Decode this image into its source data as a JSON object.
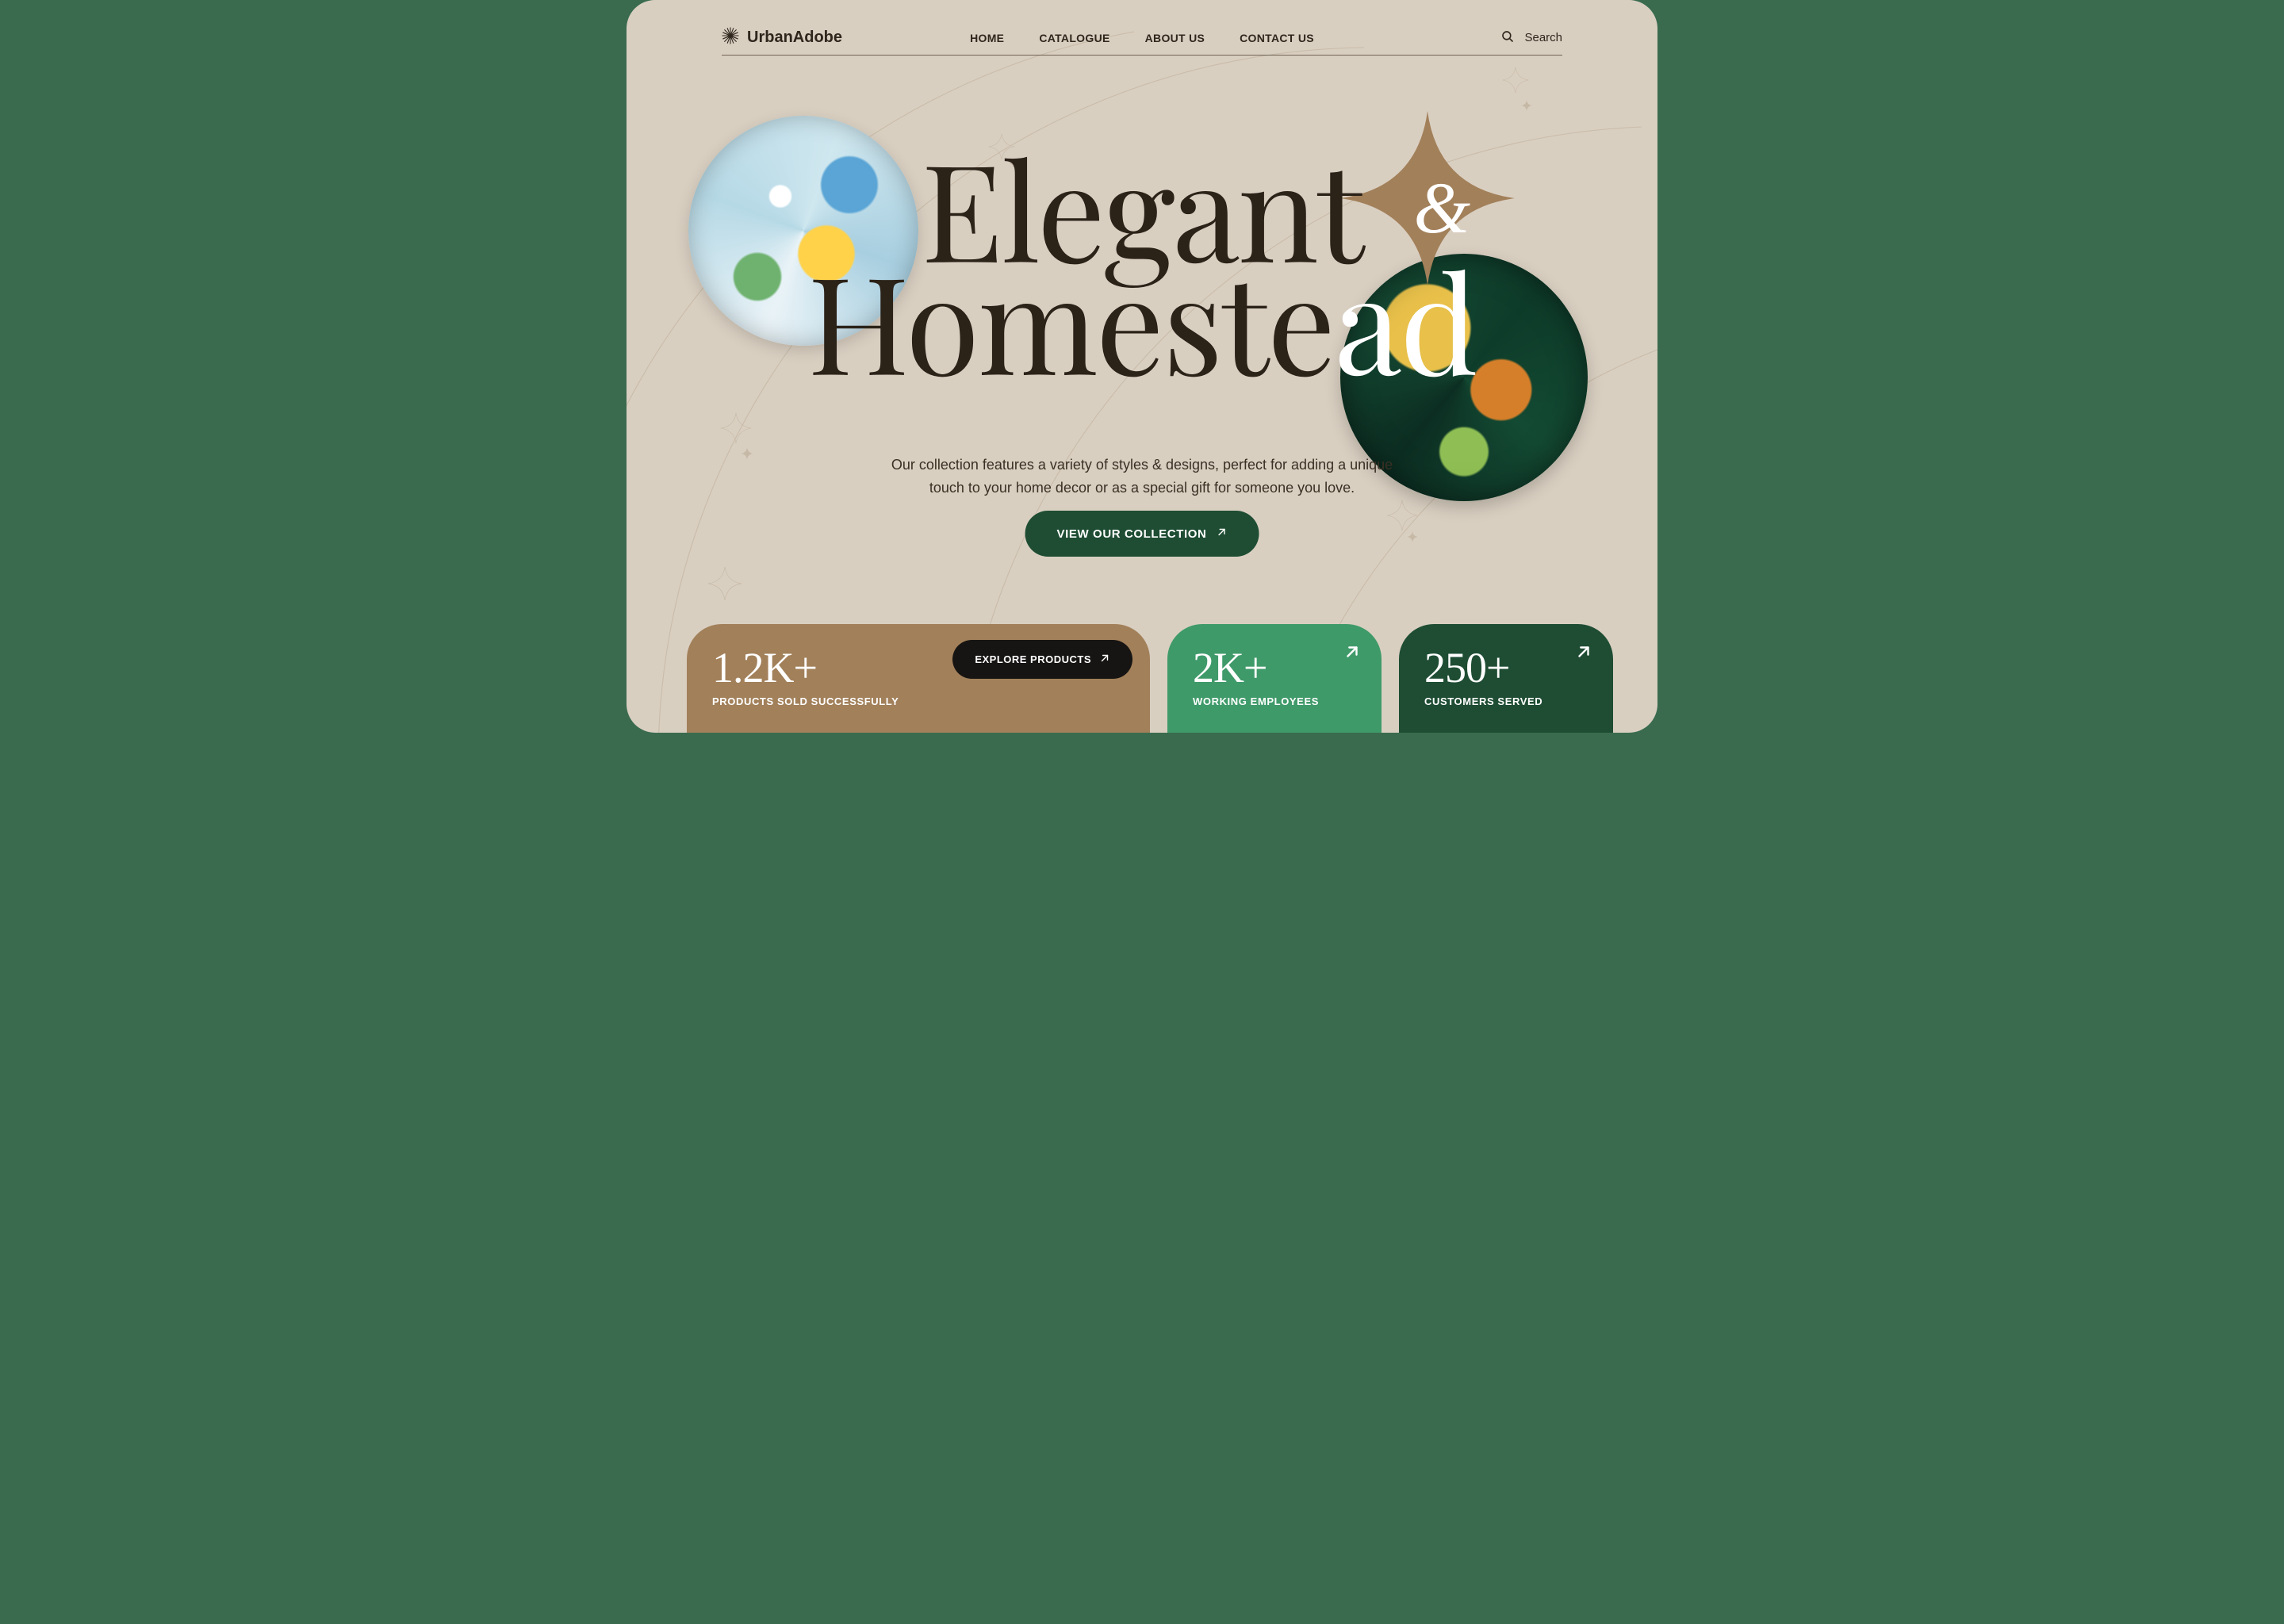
{
  "brand": {
    "name": "UrbanAdobe"
  },
  "nav": {
    "items": [
      {
        "label": "HOME"
      },
      {
        "label": "CATALOGUE"
      },
      {
        "label": "ABOUT US"
      },
      {
        "label": "CONTACT US"
      }
    ]
  },
  "search": {
    "label": "Search"
  },
  "hero": {
    "line1": "Elegant",
    "line2_prefix": "Homeste",
    "line2_suffix": "ad",
    "amp": "&",
    "sub_line1": "Our collection features a variety of styles & designs, perfect for adding a unique",
    "sub_line2": "touch to your home decor or as a special gift for someone you love.",
    "cta_label": "VIEW OUR COLLECTION"
  },
  "stats": {
    "card1": {
      "value": "1.2K+",
      "label": "PRODUCTS SOLD SUCCESSFULLY",
      "button": "EXPLORE PRODUCTS"
    },
    "card2": {
      "value": "2K+",
      "label": "WORKING EMPLOYEES"
    },
    "card3": {
      "value": "250+",
      "label": "CUSTOMERS SERVED"
    }
  },
  "colors": {
    "page_bg": "#d9cfc1",
    "accent_brown": "#a2805a",
    "accent_green": "#3f9a6a",
    "accent_dark_green": "#1e4d33",
    "text_dark": "#2b2218"
  }
}
